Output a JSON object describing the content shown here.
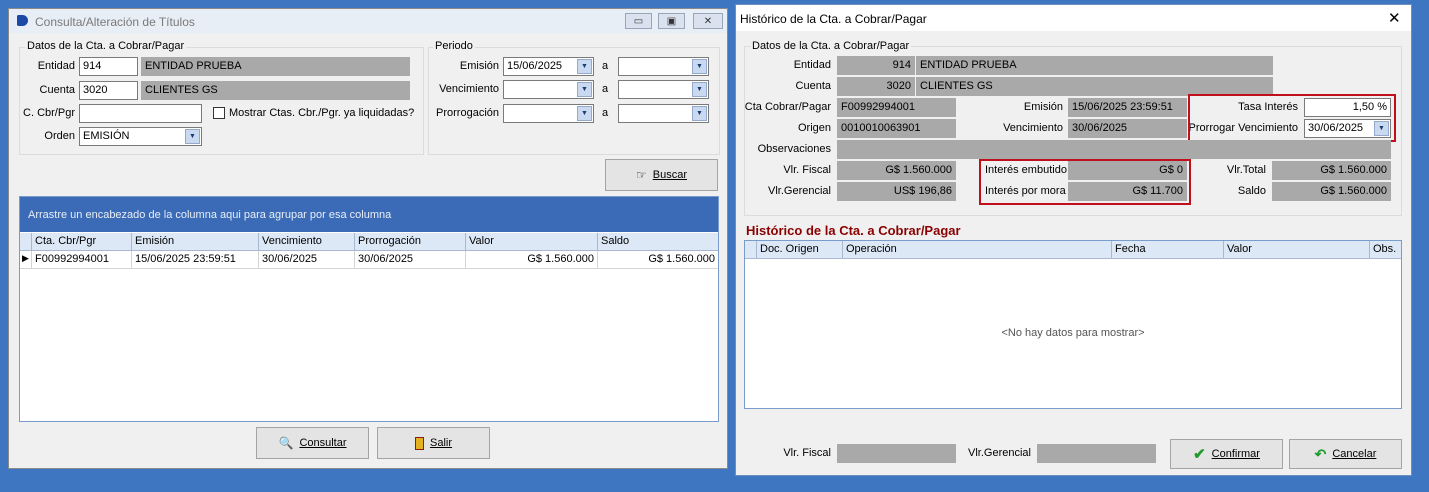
{
  "left_window": {
    "title": "Consulta/Alteración de Títulos",
    "datos_group": "Datos de la Cta. a Cobrar/Pagar",
    "entidad_label": "Entidad",
    "entidad_code": "914",
    "entidad_name": "ENTIDAD PRUEBA",
    "cuenta_label": "Cuenta",
    "cuenta_code": "3020",
    "cuenta_name": "CLIENTES GS",
    "cbr_label": "C. Cbr/Pgr",
    "cbr_value": "",
    "mostrar_label": "Mostrar Ctas. Cbr./Pgr. ya liquidadas?",
    "orden_label": "Orden",
    "orden_value": "EMISIÓN",
    "periodo_group": "Periodo",
    "emision_label": "Emisión",
    "emision_from": "15/06/2025",
    "emision_to": "",
    "vencimiento_label": "Vencimiento",
    "vencimiento_from": "",
    "vencimiento_to": "",
    "prorrogacion_label": "Prorrogación",
    "prorrogacion_from": "",
    "prorrogacion_to": "",
    "a_label": "a",
    "buscar_label": "Buscar",
    "group_panel_text": "Arrastre un encabezado de la columna aqui para agrupar por esa columna",
    "columns": [
      "Cta. Cbr/Pgr",
      "Emisión",
      "Vencimiento",
      "Prorrogación",
      "Valor",
      "Saldo"
    ],
    "rows": [
      [
        "F00992994001",
        "15/06/2025 23:59:51",
        "30/06/2025",
        "30/06/2025",
        "G$ 1.560.000",
        "G$ 1.560.000"
      ]
    ],
    "consultar_label": "Consultar",
    "salir_label": "Salir"
  },
  "right_window": {
    "title": "Histórico de la Cta. a Cobrar/Pagar",
    "datos_group": "Datos de la Cta. a Cobrar/Pagar",
    "entidad_label": "Entidad",
    "entidad_code": "914",
    "entidad_name": "ENTIDAD PRUEBA",
    "cuenta_label": "Cuenta",
    "cuenta_code": "3020",
    "cuenta_name": "CLIENTES GS",
    "cta_label": "Cta Cobrar/Pagar",
    "cta_value": "F00992994001",
    "emision_label": "Emisión",
    "emision_value": "15/06/2025 23:59:51",
    "tasa_label": "Tasa Interés",
    "tasa_value": "1,50 %",
    "origen_label": "Origen",
    "origen_value": "0010010063901",
    "vencimiento_label": "Vencimiento",
    "vencimiento_value": "30/06/2025",
    "prorrogar_label": "Prorrogar Vencimiento",
    "prorrogar_value": "30/06/2025",
    "observaciones_label": "Observaciones",
    "observaciones_value": "",
    "vlr_fiscal_label": "Vlr. Fiscal",
    "vlr_fiscal_value": "G$ 1.560.000",
    "interes_embutido_label": "Interés embutido",
    "interes_embutido_value": "G$ 0",
    "vlr_total_label": "Vlr.Total",
    "vlr_total_value": "G$ 1.560.000",
    "vlr_gerencial_label": "Vlr.Gerencial",
    "vlr_gerencial_value": "US$ 196,86",
    "interes_mora_label": "Interés por mora",
    "interes_mora_value": "G$ 11.700",
    "saldo_label": "Saldo",
    "saldo_value": "G$ 1.560.000",
    "historico_heading": "Histórico de la Cta. a Cobrar/Pagar",
    "hist_columns": [
      "Doc. Origen",
      "Operación",
      "Fecha",
      "Valor",
      "Obs."
    ],
    "empty_text": "<No hay datos para mostrar>",
    "footer_fiscal_label": "Vlr. Fiscal",
    "footer_fiscal_value": "",
    "footer_gerencial_label": "Vlr.Gerencial",
    "footer_gerencial_value": "",
    "confirmar_label": "Confirmar",
    "cancelar_label": "Cancelar"
  },
  "colors": {
    "desktop": "#3f76c2",
    "grid_header": "#dde8f7",
    "group_panel": "#3b6bb6",
    "highlight": "#c0101c",
    "section_title": "#8b0000"
  }
}
